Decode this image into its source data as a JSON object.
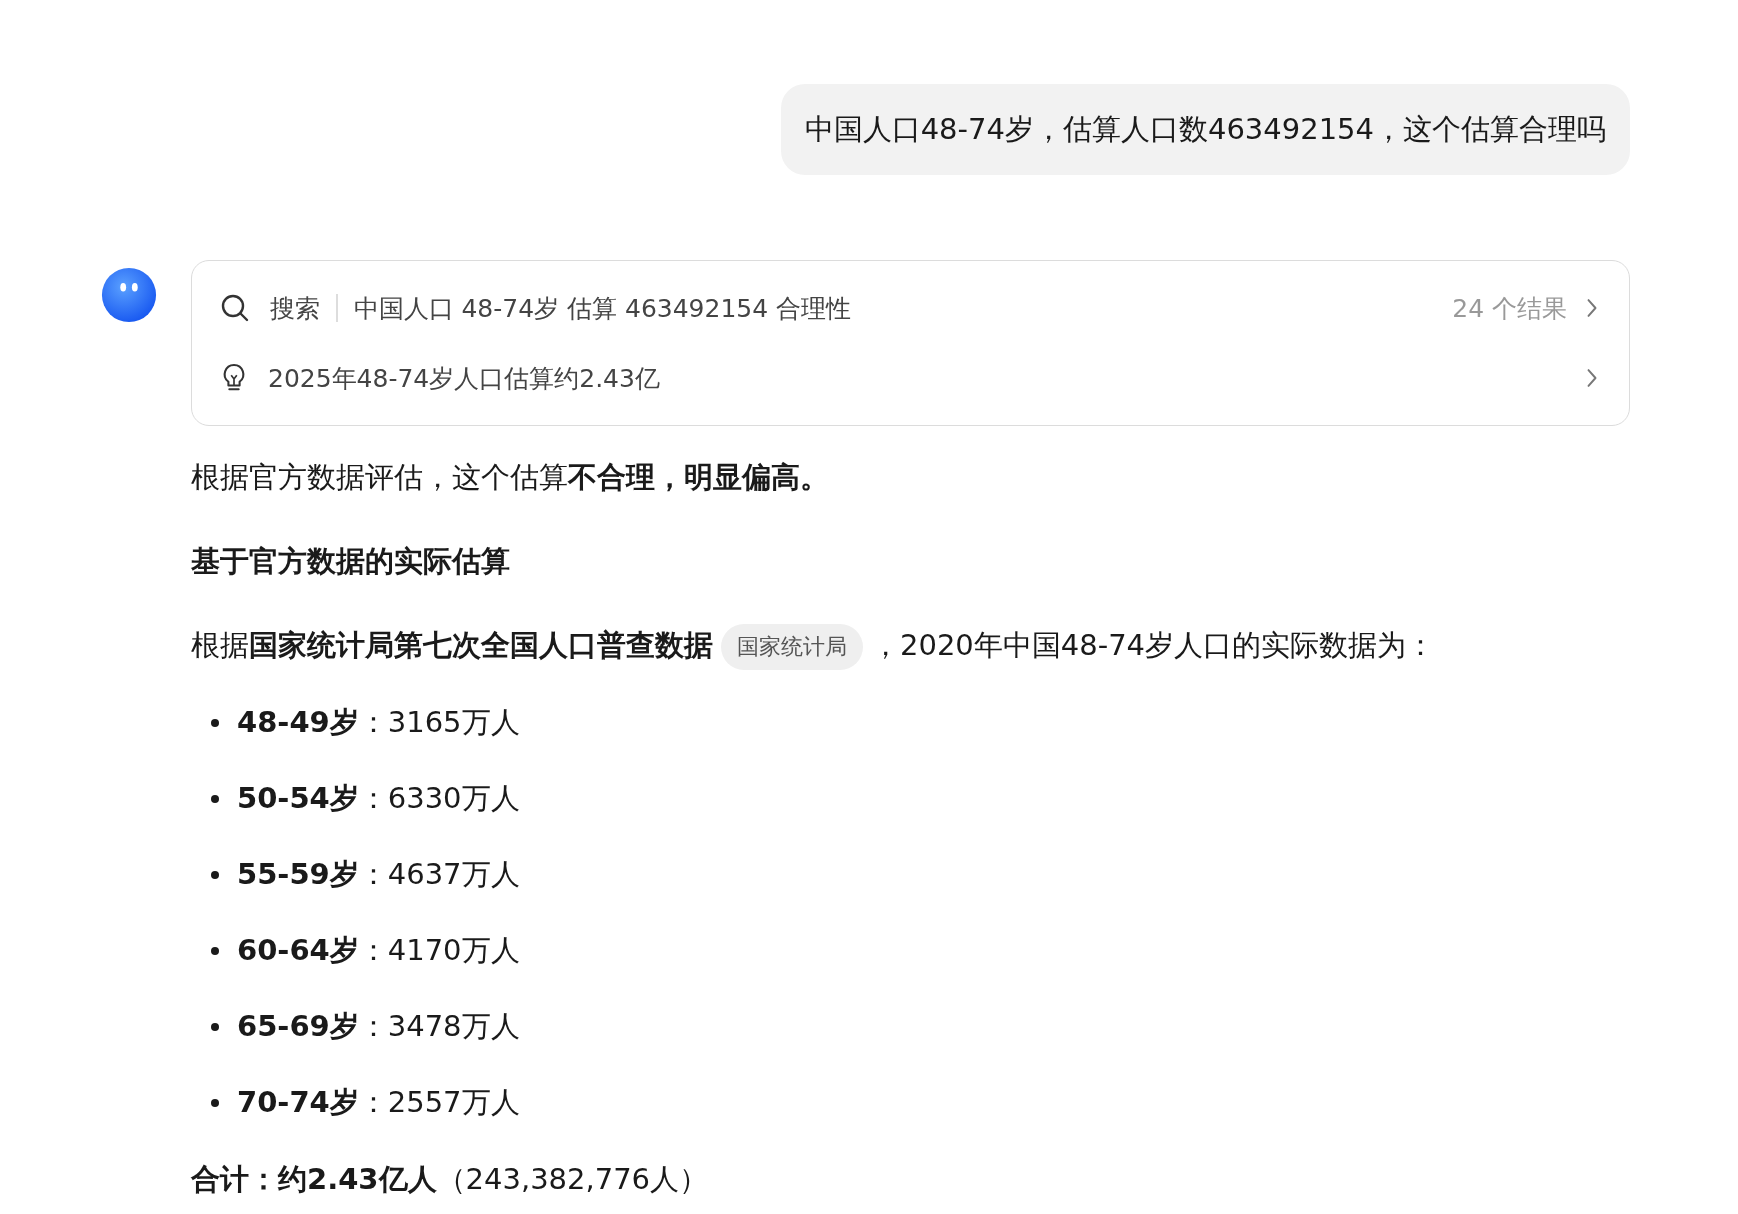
{
  "user_message": "中国人口48-74岁，估算人口数463492154，这个估算合理吗",
  "search_card": {
    "label": "搜索",
    "query": "中国人口 48-74岁 估算 463492154 合理性",
    "result_count": "24 个结果",
    "insight": "2025年48-74岁人口估算约2.43亿"
  },
  "answer": {
    "intro": "根据官方数据评估，这个估算**不合理，明显偏高。**",
    "heading": "基于官方数据的实际估算",
    "source_para": {
      "before": "根据**国家统计局第七次全国人口普查数据**",
      "citation": "国家统计局",
      "after": "，2020年中国48-74岁人口的实际数据为："
    },
    "items": [
      {
        "text": "**48-49岁**：3165万人"
      },
      {
        "text": "**50-54岁**：6330万人"
      },
      {
        "text": "**55-59岁**：4637万人"
      },
      {
        "text": "**60-64岁**：4170万人"
      },
      {
        "text": "**65-69岁**：3478万人"
      },
      {
        "text": "**70-74岁**：2557万人"
      }
    ],
    "total": "**合计：约2.43亿人**（243,382,776人）"
  }
}
